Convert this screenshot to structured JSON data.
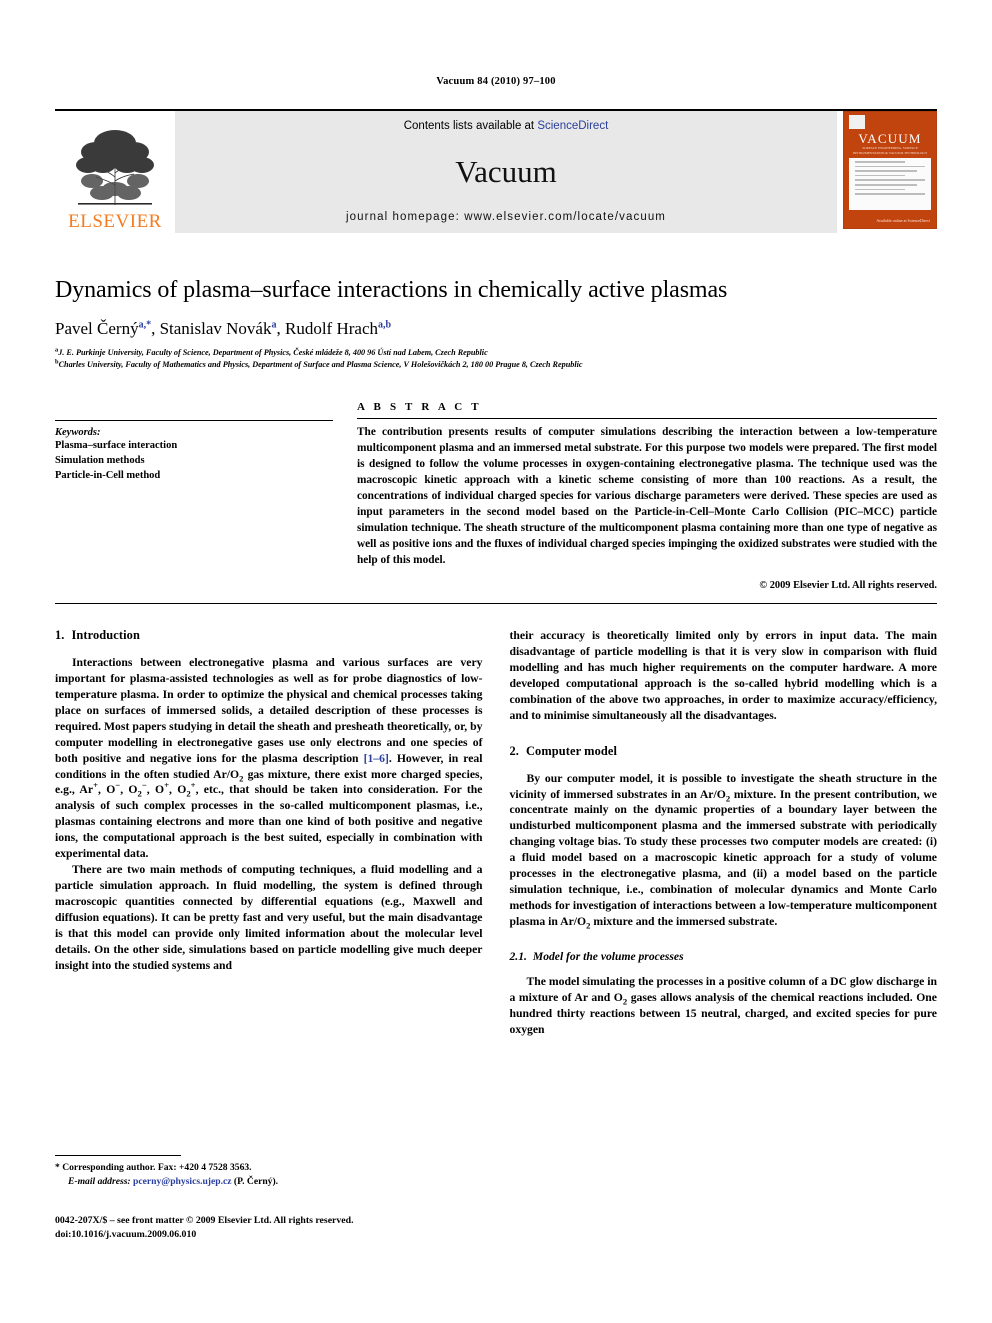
{
  "running_head": "Vacuum 84 (2010) 97–100",
  "banner": {
    "publisher_name": "ELSEVIER",
    "contents_prefix": "Contents lists available at ",
    "contents_link": "ScienceDirect",
    "journal_name": "Vacuum",
    "homepage": "journal homepage: www.elsevier.com/locate/vacuum",
    "cover": {
      "title": "VACUUM",
      "subtitle": "SURFACE ENGINEERING, SURFACE INSTRUMENTATION & VACUUM TECHNOLOGY",
      "footer": "Available online at\nScienceDirect"
    },
    "accent_orange": "#C1440E",
    "link_blue": "#2a3f9d"
  },
  "article": {
    "title": "Dynamics of plasma–surface interactions in chemically active plasmas",
    "authors": [
      {
        "name": "Pavel Černý",
        "marks": "a,*"
      },
      {
        "name": "Stanislav Novák",
        "marks": "a"
      },
      {
        "name": "Rudolf Hrach",
        "marks": "a,b"
      }
    ],
    "affiliations": [
      {
        "mark": "a",
        "text": "J. E. Purkinje University, Faculty of Science, Department of Physics, České mládeže 8, 400 96 Ústí nad Labem, Czech Republic"
      },
      {
        "mark": "b",
        "text": "Charles University, Faculty of Mathematics and Physics, Department of Surface and Plasma Science, V Holešovičkách 2, 180 00 Prague 8, Czech Republic"
      }
    ]
  },
  "keywords": {
    "heading": "Keywords:",
    "items": [
      "Plasma–surface interaction",
      "Simulation methods",
      "Particle-in-Cell method"
    ]
  },
  "abstract": {
    "label": "A B S T R A C T",
    "text": "The contribution presents results of computer simulations describing the interaction between a low-temperature multicomponent plasma and an immersed metal substrate. For this purpose two models were prepared. The first model is designed to follow the volume processes in oxygen-containing electronegative plasma. The technique used was the macroscopic kinetic approach with a kinetic scheme consisting of more than 100 reactions. As a result, the concentrations of individual charged species for various discharge parameters were derived. These species are used as input parameters in the second model based on the Particle-in-Cell–Monte Carlo Collision (PIC–MCC) particle simulation technique. The sheath structure of the multicomponent plasma containing more than one type of negative as well as positive ions and the fluxes of individual charged species impinging the oxidized substrates were studied with the help of this model.",
    "copyright": "© 2009 Elsevier Ltd. All rights reserved."
  },
  "sections": {
    "intro": {
      "number": "1.",
      "title": "Introduction",
      "p1": "Interactions between electronegative plasma and various surfaces are very important for plasma-assisted technologies as well as for probe diagnostics of low-temperature plasma. In order to optimize the physical and chemical processes taking place on surfaces of immersed solids, a detailed description of these processes is required. Most papers studying in detail the sheath and presheath theoretically, or, by computer modelling in electronegative gases use only electrons and one species of both positive and negative ions for the plasma description ",
      "p1_ref": "[1–6]",
      "p1_tail_a": ". However, in real conditions in the often studied Ar/O",
      "p1_tail_b": " gas mixture, there exist more charged species, e.g., Ar",
      "p1_species": "Ar+, O−, O2−, O+, O2+",
      "p1_tail_c": ", etc., that should be taken into consideration. For the analysis of such complex processes in the so-called multicomponent plasmas, i.e., plasmas containing electrons and more than one kind of both positive and negative ions, the computational approach is the best suited, especially in combination with experimental data.",
      "p2": "There are two main methods of computing techniques, a fluid modelling and a particle simulation approach. In fluid modelling, the system is defined through macroscopic quantities connected by differential equations (e.g., Maxwell and diffusion equations). It can be pretty fast and very useful, but the main disadvantage is that this model can provide only limited information about the molecular level details. On the other side, simulations based on particle modelling give much deeper insight into the studied systems and",
      "p2_cont": "their accuracy is theoretically limited only by errors in input data. The main disadvantage of particle modelling is that it is very slow in comparison with fluid modelling and has much higher requirements on the computer hardware. A more developed computational approach is the so-called hybrid modelling which is a combination of the above two approaches, in order to maximize accuracy/efficiency, and to minimise simultaneously all the disadvantages."
    },
    "computer_model": {
      "number": "2.",
      "title": "Computer model",
      "p1_a": "By our computer model, it is possible to investigate the sheath structure in the vicinity of immersed substrates in an Ar/O",
      "p1_b": " mixture. In the present contribution, we concentrate mainly on the dynamic properties of a boundary layer between the undisturbed multicomponent plasma and the immersed substrate with periodically changing voltage bias. To study these processes two computer models are created: (i) a fluid model based on a macroscopic kinetic approach for a study of volume processes in the electronegative plasma, and (ii) a model based on the particle simulation technique, i.e., combination of molecular dynamics and Monte Carlo methods for investigation of interactions between a low-temperature multicomponent plasma in Ar/O",
      "p1_c": " mixture and the immersed substrate."
    },
    "volume_processes": {
      "number": "2.1.",
      "title": "Model for the volume processes",
      "p1_a": "The model simulating the processes in a positive column of a DC glow discharge in a mixture of Ar and O",
      "p1_b": " gases allows analysis of the chemical reactions included. One hundred thirty reactions between 15 neutral, charged, and excited species for pure oxygen"
    }
  },
  "footnotes": {
    "corresponding": "* Corresponding author. Fax: +420 4 7528 3563.",
    "email_label": "E-mail address:",
    "email": "pcerny@physics.ujep.cz",
    "email_suffix": "(P. Černý)."
  },
  "imprint": {
    "line1": "0042-207X/$ – see front matter © 2009 Elsevier Ltd. All rights reserved.",
    "line2": "doi:10.1016/j.vacuum.2009.06.010"
  }
}
